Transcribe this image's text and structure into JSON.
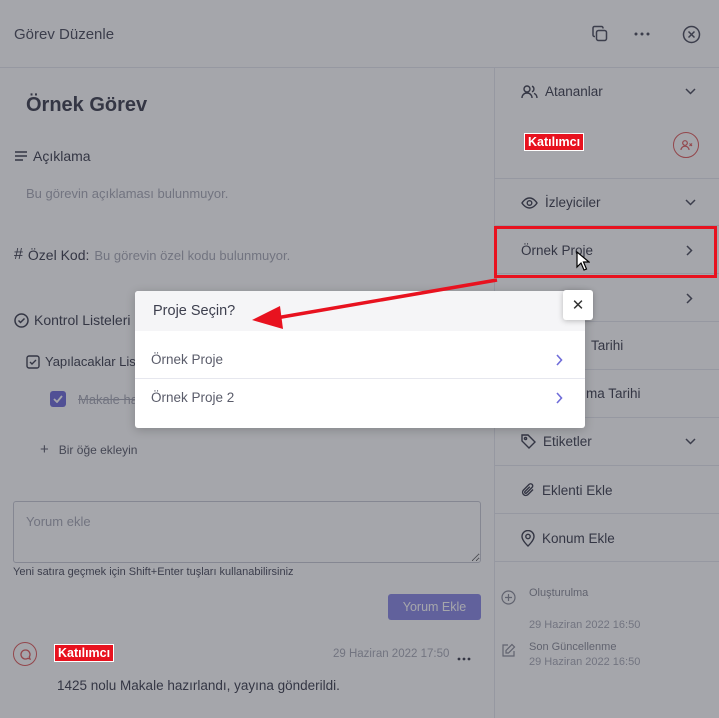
{
  "header": {
    "title": "Görev Düzenle"
  },
  "task": {
    "title": "Örnek Görev",
    "description_label": "Açıklama",
    "description_empty": "Bu görevin açıklaması bulunmuyor.",
    "special_code_label": "Özel Kod:",
    "special_code_empty": "Bu görevin özel kodu bulunmuyor.",
    "checklist_label": "Kontrol Listeleri",
    "todo_label": "Yapılacaklar Listesi",
    "todo_item": "Makale hazırla",
    "add_item": "Bir öğe ekleyin"
  },
  "comment": {
    "placeholder": "Yorum ekle",
    "hint": "Yeni satıra geçmek için Shift+Enter tuşları kullanabilirsiniz",
    "submit": "Yorum Ekle"
  },
  "activity": {
    "user": "Katılımcı",
    "date": "29 Haziran 2022 17:50",
    "text": "1425 nolu Makale hazırlandı, yayına gönderildi."
  },
  "sidebar": {
    "assignees": "Atananlar",
    "participant": "Katılımcı",
    "watchers": "İzleyiciler",
    "project": "Örnek Proje",
    "start_date": "Tarihi",
    "end_date": "ma Tarihi",
    "tags": "Etiketler",
    "add_attachment": "Eklenti Ekle",
    "add_location": "Konum Ekle",
    "created_label": "Oluşturulma",
    "created_date": "29 Haziran 2022 16:50",
    "updated_label": "Son Güncellenme",
    "updated_date": "29 Haziran 2022 16:50"
  },
  "modal": {
    "title": "Proje Seçin?",
    "items": [
      {
        "label": "Örnek Proje"
      },
      {
        "label": "Örnek Proje 2"
      }
    ],
    "close": "✕"
  },
  "colors": {
    "accent": "#6f6cd9",
    "annotation": "#e8121f"
  }
}
